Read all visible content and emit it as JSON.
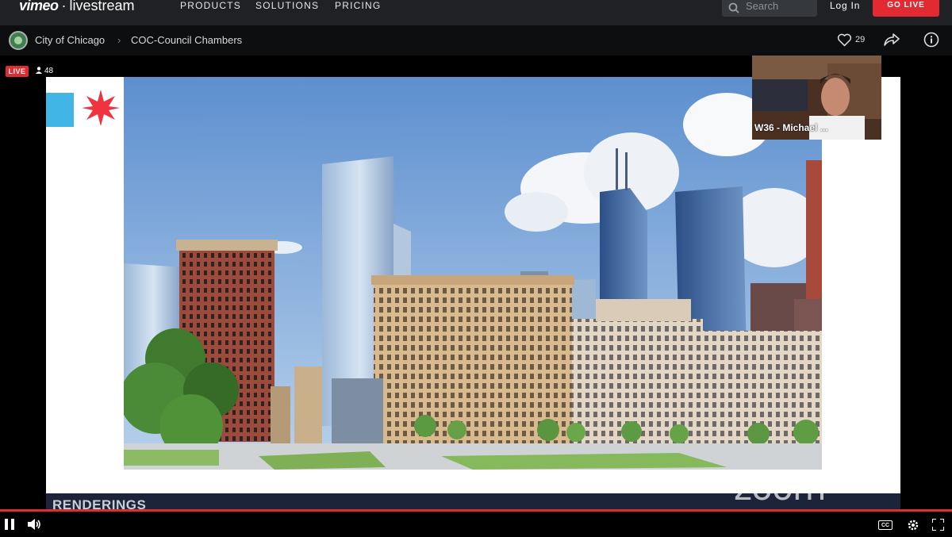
{
  "header": {
    "logo_brand": "vimeo",
    "logo_separator": "·",
    "logo_product": "livestream",
    "nav": [
      "PRODUCTS",
      "SOLUTIONS",
      "PRICING"
    ],
    "search_placeholder": "Search",
    "login_label": "Log In",
    "golive_label": "GO LIVE"
  },
  "breadcrumb": {
    "channel": "City of Chicago",
    "separator": "›",
    "event": "COC-Council Chambers"
  },
  "actions": {
    "likes": "29"
  },
  "player": {
    "live_badge": "LIVE",
    "viewer_count": "48",
    "participant_name": "W36 - Michael ...",
    "slide_title": "RENDERINGS",
    "watermark": "zoom",
    "cc_label": "CC",
    "progress_percent": 100
  },
  "colors": {
    "accent_red": "#e22a33",
    "flag_blue": "#41b6e6",
    "star_red": "#ef3340"
  }
}
